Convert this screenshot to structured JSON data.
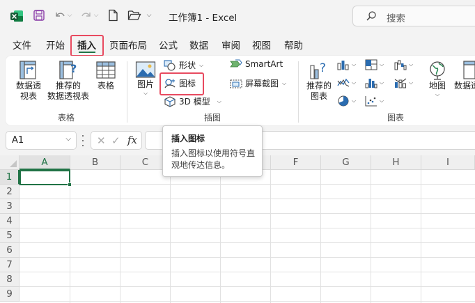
{
  "titlebar": {
    "document_title": "工作簿1  -  Excel",
    "search_placeholder": "搜索"
  },
  "tabs": [
    {
      "label": "文件"
    },
    {
      "label": "开始"
    },
    {
      "label": "插入",
      "active": true
    },
    {
      "label": "页面布局"
    },
    {
      "label": "公式"
    },
    {
      "label": "数据"
    },
    {
      "label": "审阅"
    },
    {
      "label": "视图"
    },
    {
      "label": "帮助"
    }
  ],
  "ribbon": {
    "groups": {
      "tables": {
        "label": "表格",
        "pivot_table": "数据透\n视表",
        "recommended_pivot": "推荐的\n数据透视表",
        "table": "表格"
      },
      "illustrations": {
        "label": "插图",
        "picture": "图片",
        "shapes": "形状",
        "icons": "图标",
        "models_3d": "3D 模型",
        "smartart": "SmartArt",
        "screenshot": "屏幕截图"
      },
      "charts": {
        "label": "图表",
        "recommended_charts": "推荐的\n图表",
        "maps": "地图",
        "pivot_chart": "数据透"
      }
    }
  },
  "formula_bar": {
    "name_box": "A1",
    "fx": "fx",
    "value": ""
  },
  "grid": {
    "columns": [
      "A",
      "B",
      "C",
      "D",
      "E",
      "F",
      "G",
      "H",
      "I"
    ],
    "rows": [
      "1",
      "2",
      "3",
      "4",
      "5",
      "6",
      "7",
      "8",
      "9"
    ],
    "selected_cell": "A1"
  },
  "tooltip": {
    "title": "插入图标",
    "description": "插入图标以使用符号直观地传达信息。"
  },
  "colors": {
    "excel_green": "#217346",
    "highlight_red": "#e84a5f",
    "icon_blue": "#2b6cb0"
  }
}
